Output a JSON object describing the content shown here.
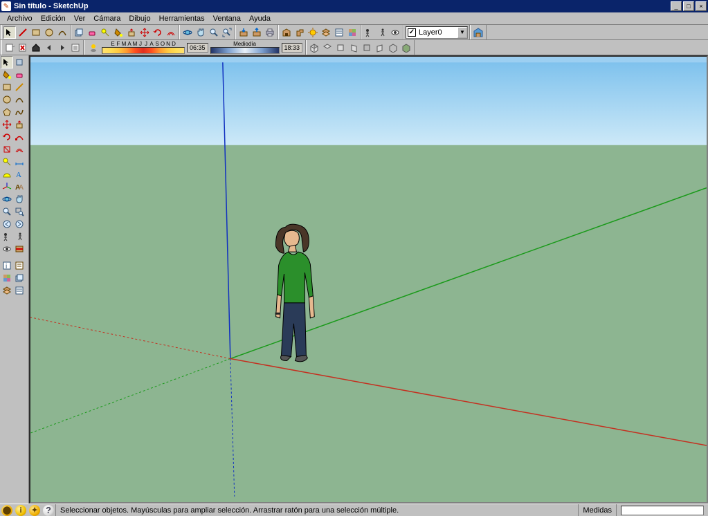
{
  "app": {
    "title": "Sin título - SketchUp",
    "icon_char": "✎"
  },
  "window_buttons": {
    "min_label": "_",
    "max_label": "□",
    "close_label": "×"
  },
  "menus": [
    "Archivo",
    "Edición",
    "Ver",
    "Cámara",
    "Dibujo",
    "Herramientas",
    "Ventana",
    "Ayuda"
  ],
  "toolbar1": {
    "tools": [
      "select",
      "line",
      "rectangle",
      "circle",
      "arc",
      "make-component",
      "eraser",
      "tape-measure",
      "paint-bucket",
      "push-pull",
      "move",
      "rotate",
      "offset",
      "orbit",
      "pan",
      "zoom",
      "zoom-extents",
      "model-info",
      "layers",
      "entity-info",
      "3d-text",
      "section-plane",
      "axes",
      "dimensions",
      "walk",
      "add-detail",
      "look-around",
      "position-camera"
    ]
  },
  "toolbar2": {
    "icons_left": [
      "page-new",
      "page-delete",
      "scene-home",
      "scene-back",
      "scene-fwd",
      "scene-list"
    ],
    "shadow_toggle_label": "☀",
    "months": [
      "E",
      "F",
      "M",
      "A",
      "M",
      "J",
      "J",
      "A",
      "S",
      "O",
      "N",
      "D"
    ],
    "time_start": "06:35",
    "time_mid": "Mediodía",
    "time_end": "18:33",
    "right_icons": [
      "iso",
      "top",
      "front",
      "right",
      "back",
      "left",
      "wire",
      "shaded"
    ]
  },
  "layer": {
    "name": "Layer0",
    "checked": "✓"
  },
  "warehouse_icon": "3d-warehouse",
  "left_tools": [
    [
      "select",
      "component-paint"
    ],
    [
      "paint-bucket",
      "eraser"
    ],
    [
      "rectangle",
      "line"
    ],
    [
      "circle",
      "arc"
    ],
    [
      "polygon",
      "freehand"
    ],
    [
      "move",
      "push-pull"
    ],
    [
      "rotate",
      "follow-me"
    ],
    [
      "scale",
      "offset"
    ],
    [
      "tape",
      "dimension"
    ],
    [
      "protractor",
      "text"
    ],
    [
      "axes",
      "3d-text"
    ],
    [
      "orbit",
      "pan"
    ],
    [
      "zoom",
      "zoom-window"
    ],
    [
      "prev-view",
      "next-view"
    ],
    [
      "position-camera",
      "walk"
    ],
    [
      "look-around",
      "section"
    ]
  ],
  "left_tools2": [
    [
      "model-info",
      "entity-info"
    ],
    [
      "materials",
      "components"
    ],
    [
      "layers-dlg",
      "outliner"
    ]
  ],
  "colors": {
    "sky": "#a9d9f4",
    "ground": "#8db591",
    "axis_x": "#c43020",
    "axis_y": "#1a9a1a",
    "axis_z": "#1030c0"
  },
  "statusbar": {
    "hint": "Seleccionar objetos. Mayúsculas para ampliar selección. Arrastrar ratón para una selección múltiple.",
    "measures_label": "Medidas",
    "measures_value": ""
  }
}
